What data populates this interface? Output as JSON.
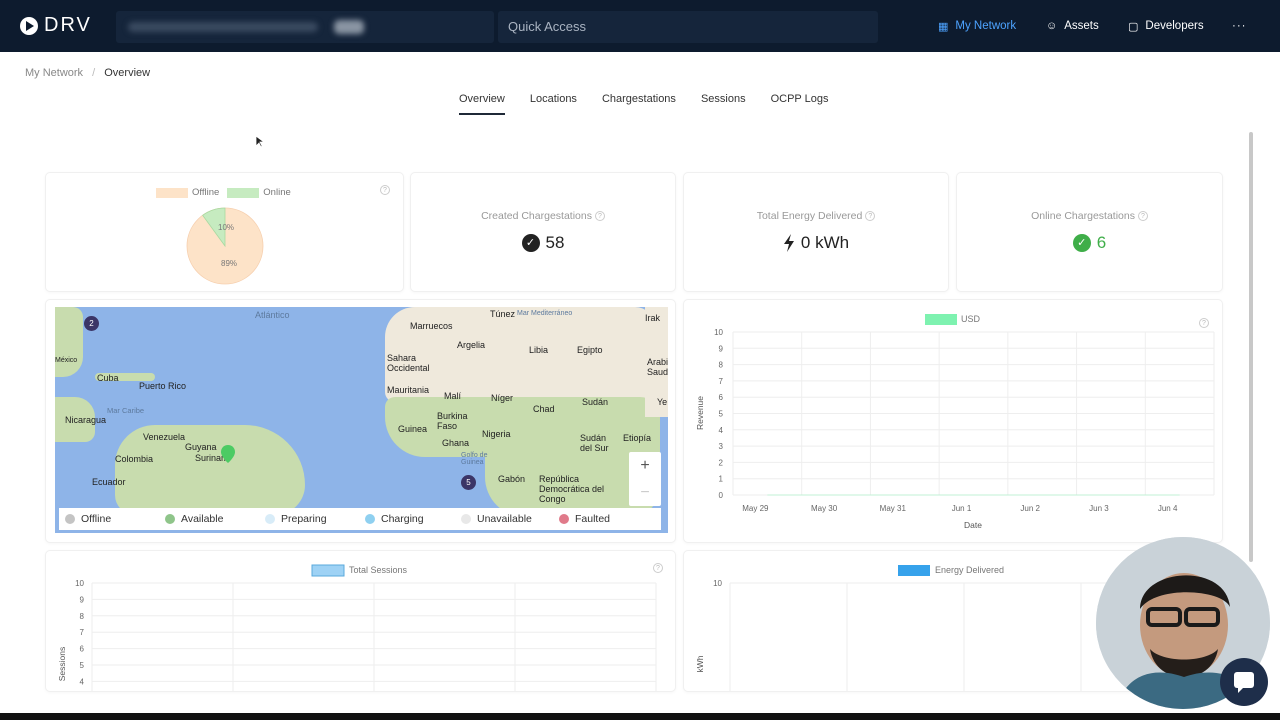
{
  "app": {
    "logo_text": "DRV",
    "quick_access_placeholder": "Quick Access"
  },
  "nav": {
    "items": [
      {
        "label": "My Network",
        "icon": "network-icon",
        "active": true
      },
      {
        "label": "Assets",
        "icon": "users-icon"
      },
      {
        "label": "Developers",
        "icon": "code-icon"
      },
      {
        "label": "···",
        "icon": "more-icon"
      }
    ]
  },
  "breadcrumb": {
    "root": "My Network",
    "separator": "/",
    "current": "Overview"
  },
  "tabs": [
    "Overview",
    "Locations",
    "Chargestations",
    "Sessions",
    "OCPP Logs"
  ],
  "status_pie": {
    "legend": [
      "Offline",
      "Online"
    ],
    "labels": [
      "10%",
      "89%"
    ],
    "colors": {
      "offline": "#fde3c8",
      "online": "#c6ebc0"
    }
  },
  "stats": {
    "created": {
      "label": "Created Chargestations",
      "value": "58"
    },
    "energy": {
      "label": "Total Energy Delivered",
      "value": "0 kWh"
    },
    "online": {
      "label": "Online Chargestations",
      "value": "6"
    }
  },
  "map": {
    "labels": [
      "Atlántico",
      "Marruecos",
      "Túnez",
      "Mar Mediterráneo",
      "Irak",
      "Argelia",
      "Libia",
      "Egipto",
      "Sahara Occidental",
      "Arabia Saudí",
      "Mauritania",
      "Malí",
      "Níger",
      "Chad",
      "Sudán",
      "Cuba",
      "Puerto Rico",
      "México",
      "Mar Caribe",
      "Nicaragua",
      "Venezuela",
      "Guyana",
      "Surinam",
      "Colombia",
      "Ecuador",
      "Burkina Faso",
      "Guinea",
      "Ghana",
      "Nigeria",
      "Sudán del Sur",
      "Etiopía",
      "Golfo de Guinea",
      "Gabón",
      "República Democrática del Congo",
      "Ye"
    ],
    "clusters": [
      "2",
      "5"
    ],
    "zoom_in": "+",
    "zoom_out": "−",
    "legend": [
      {
        "label": "Offline",
        "color": "#c4c4c4"
      },
      {
        "label": "Available",
        "color": "#8fc58a"
      },
      {
        "label": "Preparing",
        "color": "#d8ecf8"
      },
      {
        "label": "Charging",
        "color": "#8fd0f0"
      },
      {
        "label": "Unavailable",
        "color": "#e8e8e8"
      },
      {
        "label": "Faulted",
        "color": "#e07a8a"
      }
    ]
  },
  "chart_data": [
    {
      "type": "line",
      "legend": [
        "USD"
      ],
      "ylabel": "Revenue",
      "xlabel": "Date",
      "categories": [
        "May 29",
        "May 30",
        "May 31",
        "Jun 1",
        "Jun 2",
        "Jun 3",
        "Jun 4"
      ],
      "yticks": [
        0,
        1,
        2,
        3,
        4,
        5,
        6,
        7,
        8,
        9,
        10
      ],
      "ylim": [
        0,
        10
      ],
      "series": [
        {
          "name": "USD",
          "color": "#7ef2b0",
          "values": [
            0,
            0,
            0,
            0,
            0,
            0,
            0
          ]
        }
      ]
    },
    {
      "type": "bar",
      "legend": [
        "Total Sessions"
      ],
      "ylabel": "Sessions",
      "yticks": [
        4,
        5,
        6,
        7,
        8,
        9,
        10
      ],
      "ylim": [
        0,
        10
      ],
      "series": [
        {
          "name": "Total Sessions",
          "color": "#9ed2f5"
        }
      ]
    },
    {
      "type": "bar",
      "legend": [
        "Energy Delivered"
      ],
      "ylabel": "kWh",
      "yticks": [
        10
      ],
      "ylim": [
        0,
        10
      ],
      "series": [
        {
          "name": "Energy Delivered",
          "color": "#36a2eb"
        }
      ]
    }
  ]
}
